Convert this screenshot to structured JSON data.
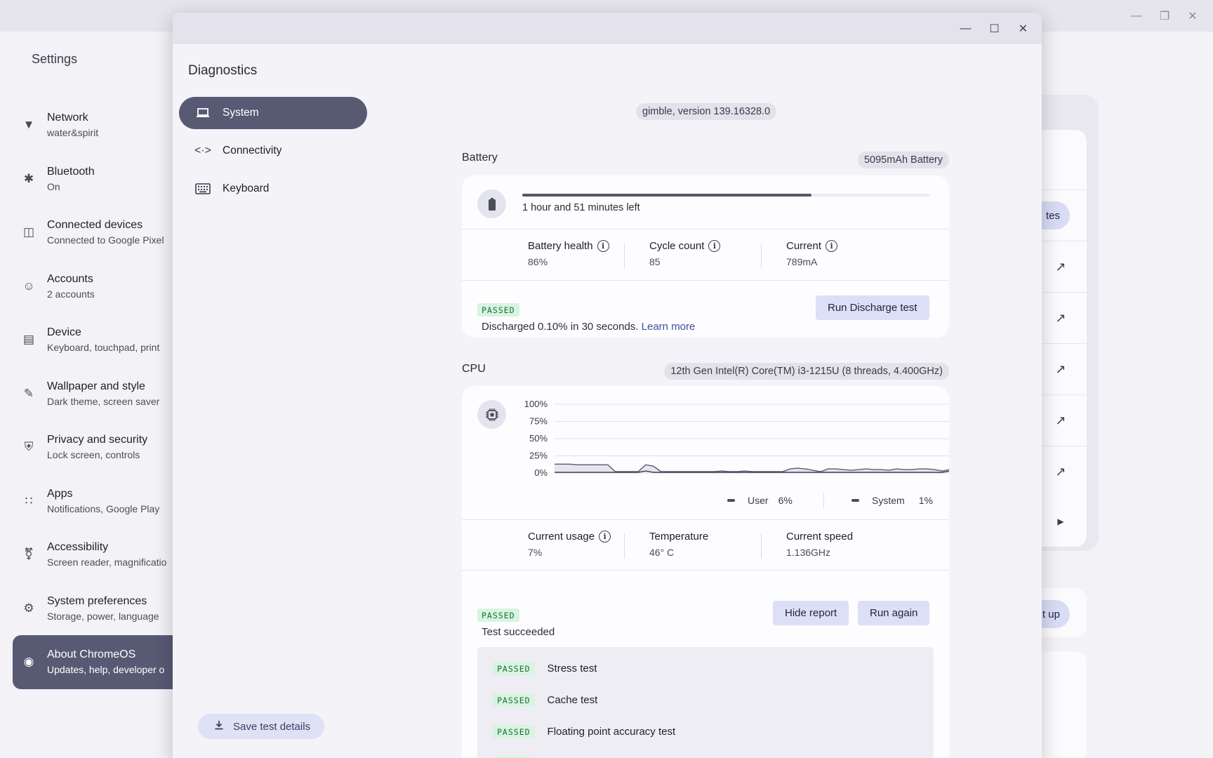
{
  "settings": {
    "title": "Settings",
    "nav": [
      {
        "label": "Network",
        "sub": "water&spirit",
        "icon": "wifi-icon"
      },
      {
        "label": "Bluetooth",
        "sub": "On",
        "icon": "bluetooth-icon"
      },
      {
        "label": "Connected devices",
        "sub": "Connected to Google Pixel",
        "icon": "connected-devices-icon"
      },
      {
        "label": "Accounts",
        "sub": "2 accounts",
        "icon": "accounts-icon"
      },
      {
        "label": "Device",
        "sub": "Keyboard, touchpad, print",
        "icon": "laptop-icon"
      },
      {
        "label": "Wallpaper and style",
        "sub": "Dark theme, screen saver",
        "icon": "palette-icon"
      },
      {
        "label": "Privacy and security",
        "sub": "Lock screen, controls",
        "icon": "shield-icon"
      },
      {
        "label": "Apps",
        "sub": "Notifications, Google Play",
        "icon": "apps-grid-icon"
      },
      {
        "label": "Accessibility",
        "sub": "Screen reader, magnificatio",
        "icon": "accessibility-icon"
      },
      {
        "label": "System preferences",
        "sub": "Storage, power, language",
        "icon": "gear-icon"
      },
      {
        "label": "About ChromeOS",
        "sub": "Updates, help, developer o",
        "icon": "chrome-icon",
        "active": true
      }
    ],
    "right_buttons": {
      "updates_partial": "tes",
      "setup_partial": "t up"
    }
  },
  "diagnostics": {
    "title": "Diagnostics",
    "nav": [
      {
        "label": "System",
        "icon": "laptop-icon"
      },
      {
        "label": "Connectivity",
        "icon": "connectivity-icon"
      },
      {
        "label": "Keyboard",
        "icon": "keyboard-icon"
      }
    ],
    "save_label": "Save test details",
    "version": "gimble, version 139.16328.0",
    "battery": {
      "title": "Battery",
      "pill": "5095mAh Battery",
      "time_left": "1 hour and 51 minutes left",
      "charge_fraction": 0.71,
      "health_label": "Battery health",
      "health_value": "86%",
      "cycle_label": "Cycle count",
      "cycle_value": "85",
      "current_label": "Current",
      "current_value": "789mA",
      "badge": "PASSED",
      "result": "Discharged 0.10% in 30 seconds.",
      "learn_more": "Learn more",
      "button": "Run Discharge test"
    },
    "cpu": {
      "title": "CPU",
      "pill": "12th Gen Intel(R) Core(TM) i3-1215U (8 threads, 4.400GHz)",
      "legend_user": "User",
      "legend_user_value": "6%",
      "legend_system": "System",
      "legend_system_value": "1%",
      "usage_label": "Current usage",
      "usage_value": "7%",
      "temp_label": "Temperature",
      "temp_value": "46° C",
      "speed_label": "Current speed",
      "speed_value": "1.136GHz",
      "badge": "PASSED",
      "result": "Test succeeded",
      "hide_button": "Hide report",
      "run_button": "Run again",
      "report": [
        {
          "badge": "PASSED",
          "label": "Stress test"
        },
        {
          "badge": "PASSED",
          "label": "Cache test"
        },
        {
          "badge": "PASSED",
          "label": "Floating point accuracy test"
        }
      ]
    }
  },
  "chart_data": {
    "type": "area",
    "ylim": [
      0,
      100
    ],
    "yticks": [
      "100%",
      "75%",
      "50%",
      "25%",
      "0%"
    ],
    "series": [
      {
        "name": "User",
        "values": [
          13,
          13,
          13,
          12,
          12,
          12,
          12,
          12,
          2,
          2,
          2,
          2,
          12,
          10,
          2,
          2,
          2,
          2,
          2,
          2,
          2,
          2,
          3,
          2,
          2,
          3,
          2,
          2,
          2,
          2,
          2,
          6,
          7,
          6,
          4,
          2,
          6,
          6,
          5,
          4,
          5,
          6,
          5,
          5,
          4,
          6,
          5,
          5,
          6,
          6,
          5,
          3,
          5
        ]
      },
      {
        "name": "System",
        "values": [
          1,
          1,
          1,
          1,
          1,
          1,
          1,
          1,
          1,
          1,
          1,
          1,
          3,
          1,
          1,
          1,
          1,
          1,
          1,
          1,
          1,
          1,
          1,
          1,
          1,
          1,
          1,
          1,
          1,
          1,
          1,
          1,
          1,
          1,
          1,
          1,
          1,
          1,
          1,
          1,
          1,
          1,
          1,
          1,
          1,
          1,
          1,
          1,
          1,
          1,
          1,
          1,
          3
        ]
      }
    ]
  }
}
